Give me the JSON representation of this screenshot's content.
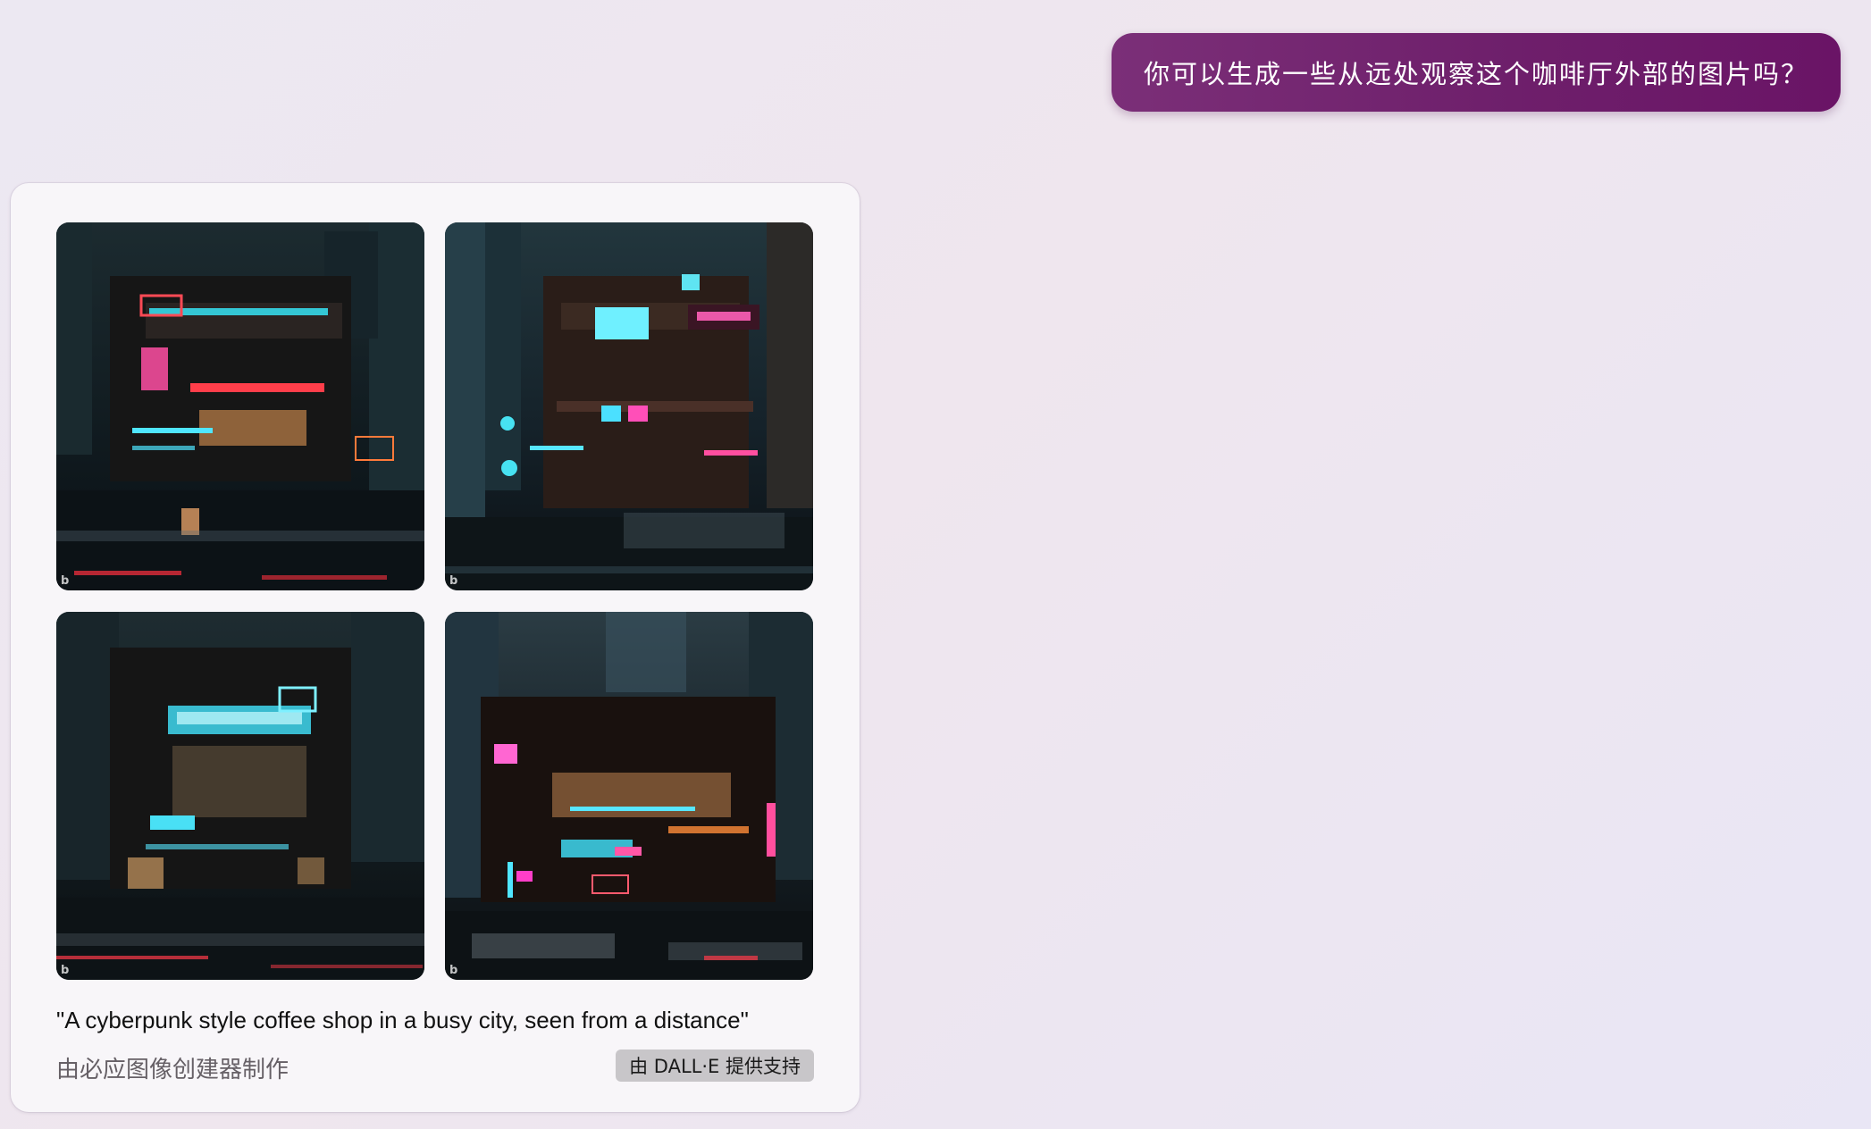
{
  "user_message": {
    "text": "你可以生成一些从远处观察这个咖啡厅外部的图片吗？"
  },
  "response": {
    "images": [
      {
        "alt": "Cyberpunk coffee shop at night with red and cyan neon signs",
        "watermark": "b"
      },
      {
        "alt": "Round cyberpunk building with cyan screen and pink neon sign",
        "watermark": "b"
      },
      {
        "alt": "Dark multi-level building with cyan neon sign in fog",
        "watermark": "b"
      },
      {
        "alt": "Cyberpunk storefront with pink and orange neon lights",
        "watermark": "b"
      }
    ],
    "prompt_caption": "\"A cyberpunk style coffee shop in a busy city, seen from a distance\"",
    "creator_label": "由必应图像创建器制作",
    "badge_label": "由 DALL·E 提供支持"
  },
  "colors": {
    "user_bubble": "#6e1f6b",
    "card_background": "#f8f6f9",
    "badge_background": "#c8c6c9"
  }
}
